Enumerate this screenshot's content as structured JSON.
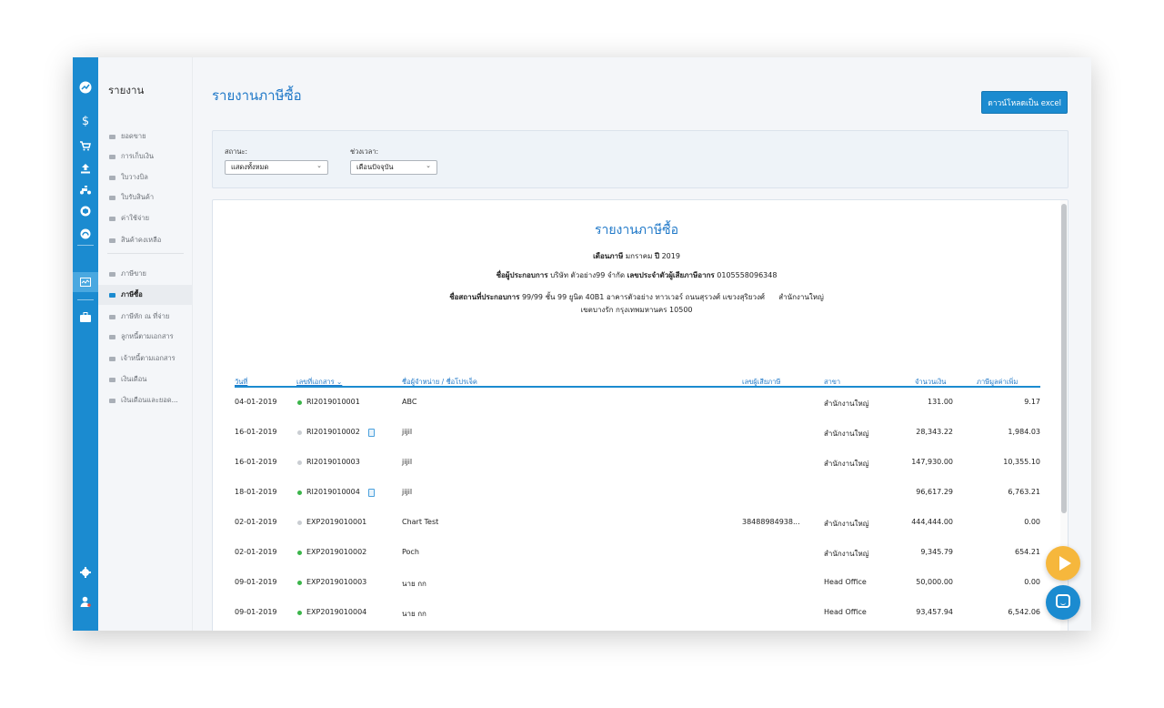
{
  "rail": {
    "icons": [
      "trend-icon",
      "dollar-icon",
      "cart-icon",
      "upload-icon",
      "scooter-icon",
      "box-icon",
      "gauge-icon",
      "report-icon",
      "briefcase-icon"
    ],
    "bottom_icons": [
      "gear-icon",
      "user-icon"
    ]
  },
  "subnav": {
    "title": "รายงาน",
    "group1": [
      "ยอดขาย",
      "การเก็บเงิน",
      "ใบวางบิล",
      "ใบรับสินค้า",
      "ค่าใช้จ่าย",
      "สินค้าคงเหลือ"
    ],
    "group2": [
      "ภาษีขาย",
      "ภาษีซื้อ",
      "ภาษีหัก ณ ที่จ่าย",
      "ลูกหนี้ตามเอกสาร",
      "เจ้าหนี้ตามเอกสาร",
      "เงินเดือน",
      "เงินเดือนและยอด..."
    ],
    "active_item": "ภาษีซื้อ"
  },
  "page": {
    "title": "รายงานภาษีซื้อ",
    "excel_button": "ดาวน์โหลดเป็น excel"
  },
  "filters": {
    "status_label": "สถานะ:",
    "status_value": "แสดงทั้งหมด",
    "period_label": "ช่วงเวลา:",
    "period_value": "เดือนปัจจุบัน"
  },
  "report": {
    "title": "รายงานภาษีซื้อ",
    "month_label": "เดือนภาษี",
    "month_value": "มกราคม",
    "year_label": "ปี",
    "year_value": "2019",
    "operator_label": "ชื่อผู้ประกอบการ",
    "operator_value": "บริษัท ตัวอย่าง99 จำกัด",
    "taxid_label": "เลขประจำตัวผู้เสียภาษีอากร",
    "taxid_value": "0105558096348",
    "address_label": "ชื่อสถานที่ประกอบการ",
    "address_value": "99/99 ชั้น 99 ยูนิต 40B1 อาคารตัวอย่าง ทาวเวอร์ ถนนสุรวงศ์ แขวงสุริยวงศ์",
    "branch_value": "สำนักงานใหญ่",
    "address_line2": "เขตบางรัก กรุงเทพมหานคร 10500",
    "columns": {
      "date": "วันที่",
      "doc_no": "เลขที่เอกสาร ⌄",
      "vendor": "ชื่อผู้จำหน่าย / ชื่อโปรเจ็ค",
      "taxpayer": "เลขผู้เสียภาษี",
      "branch": "สาขา",
      "amount": "จำนวนเงิน",
      "vat": "ภาษีมูลค่าเพิ่ม"
    },
    "rows": [
      {
        "date": "04-01-2019",
        "status": "green",
        "doc": "RI2019010001",
        "attach": false,
        "vendor": "ABC",
        "taxpayer": "",
        "branch": "สำนักงานใหญ่",
        "amount": "131.00",
        "vat": "9.17"
      },
      {
        "date": "16-01-2019",
        "status": "grey",
        "doc": "RI2019010002",
        "attach": true,
        "vendor": "jijil",
        "taxpayer": "",
        "branch": "สำนักงานใหญ่",
        "amount": "28,343.22",
        "vat": "1,984.03"
      },
      {
        "date": "16-01-2019",
        "status": "grey",
        "doc": "RI2019010003",
        "attach": false,
        "vendor": "jijil",
        "taxpayer": "",
        "branch": "สำนักงานใหญ่",
        "amount": "147,930.00",
        "vat": "10,355.10"
      },
      {
        "date": "18-01-2019",
        "status": "green",
        "doc": "RI2019010004",
        "attach": true,
        "vendor": "jijil",
        "taxpayer": "",
        "branch": "",
        "amount": "96,617.29",
        "vat": "6,763.21"
      },
      {
        "date": "02-01-2019",
        "status": "grey",
        "doc": "EXP2019010001",
        "attach": false,
        "vendor": "Chart Test",
        "taxpayer": "38488984938...",
        "branch": "สำนักงานใหญ่",
        "amount": "444,444.00",
        "vat": "0.00"
      },
      {
        "date": "02-01-2019",
        "status": "green",
        "doc": "EXP2019010002",
        "attach": false,
        "vendor": "Poch",
        "taxpayer": "",
        "branch": "สำนักงานใหญ่",
        "amount": "9,345.79",
        "vat": "654.21"
      },
      {
        "date": "09-01-2019",
        "status": "green",
        "doc": "EXP2019010003",
        "attach": false,
        "vendor": "นาย กก",
        "taxpayer": "",
        "branch": "Head Office",
        "amount": "50,000.00",
        "vat": "0.00"
      },
      {
        "date": "09-01-2019",
        "status": "green",
        "doc": "EXP2019010004",
        "attach": false,
        "vendor": "นาย กก",
        "taxpayer": "",
        "branch": "Head Office",
        "amount": "93,457.94",
        "vat": "6,542.06"
      }
    ]
  },
  "colors": {
    "brand": "#1b8bd0",
    "status_green": "#3bb54a",
    "status_grey": "#c9cdd2",
    "fab_play": "#f6b73c"
  }
}
